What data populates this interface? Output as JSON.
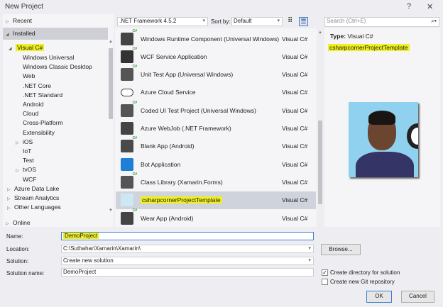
{
  "window": {
    "title": "New Project",
    "help": "?",
    "close": "✕"
  },
  "tree": {
    "recent": "Recent",
    "installed": "Installed",
    "visual_csharp": "Visual C#",
    "children": [
      "Windows Universal",
      "Windows Classic Desktop",
      "Web",
      ".NET Core",
      ".NET Standard",
      "Android",
      "Cloud",
      "Cross-Platform",
      "Extensibility",
      "iOS",
      "IoT",
      "Test",
      "tvOS",
      "WCF"
    ],
    "others": [
      "Azure Data Lake",
      "Stream Analytics",
      "Other Languages"
    ],
    "online": "Online"
  },
  "toolbar": {
    "framework": ".NET Framework 4.5.2",
    "sort_label": "Sort by:",
    "sort_value": "Default"
  },
  "search": {
    "placeholder": "Search (Ctrl+E)"
  },
  "templates": [
    {
      "name": "Windows Runtime Component (Universal Windows)",
      "lang": "Visual C#",
      "icon": "winrt-component-icon"
    },
    {
      "name": "WCF Service Application",
      "lang": "Visual C#",
      "icon": "wcf-service-icon"
    },
    {
      "name": "Unit Test App (Universal Windows)",
      "lang": "Visual C#",
      "icon": "unit-test-icon"
    },
    {
      "name": "Azure Cloud Service",
      "lang": "Visual C#",
      "icon": "cloud-icon"
    },
    {
      "name": "Coded UI Test Project (Universal Windows)",
      "lang": "Visual C#",
      "icon": "coded-ui-test-icon"
    },
    {
      "name": "Azure WebJob (.NET Framework)",
      "lang": "Visual C#",
      "icon": "webjob-icon"
    },
    {
      "name": "Blank App (Android)",
      "lang": "Visual C#",
      "icon": "android-app-icon"
    },
    {
      "name": "Bot Application",
      "lang": "Visual C#",
      "icon": "bot-icon"
    },
    {
      "name": "Class Library (Xamarin.Forms)",
      "lang": "Visual C#",
      "icon": "class-library-icon"
    },
    {
      "name": "csharpcornerProjectTemplate",
      "lang": "Visual C#",
      "icon": "custom-template-icon"
    },
    {
      "name": "Wear App (Android)",
      "lang": "Visual C#",
      "icon": "wear-app-icon"
    }
  ],
  "details": {
    "type_label": "Type:",
    "type_value": "Visual C#",
    "template_name": "csharpcornerProjectTemplate"
  },
  "form": {
    "name_label": "Name:",
    "name_value": "DemoProject",
    "location_label": "Location:",
    "location_value": "C:\\Suthahar\\Xamarin\\Xamarin\\",
    "browse": "Browse...",
    "solution_label": "Solution:",
    "solution_value": "Create new solution",
    "solution_name_label": "Solution name:",
    "solution_name_value": "DemoProject",
    "create_dir": "Create directory for solution",
    "create_git": "Create new Git repository",
    "ok": "OK",
    "cancel": "Cancel"
  }
}
